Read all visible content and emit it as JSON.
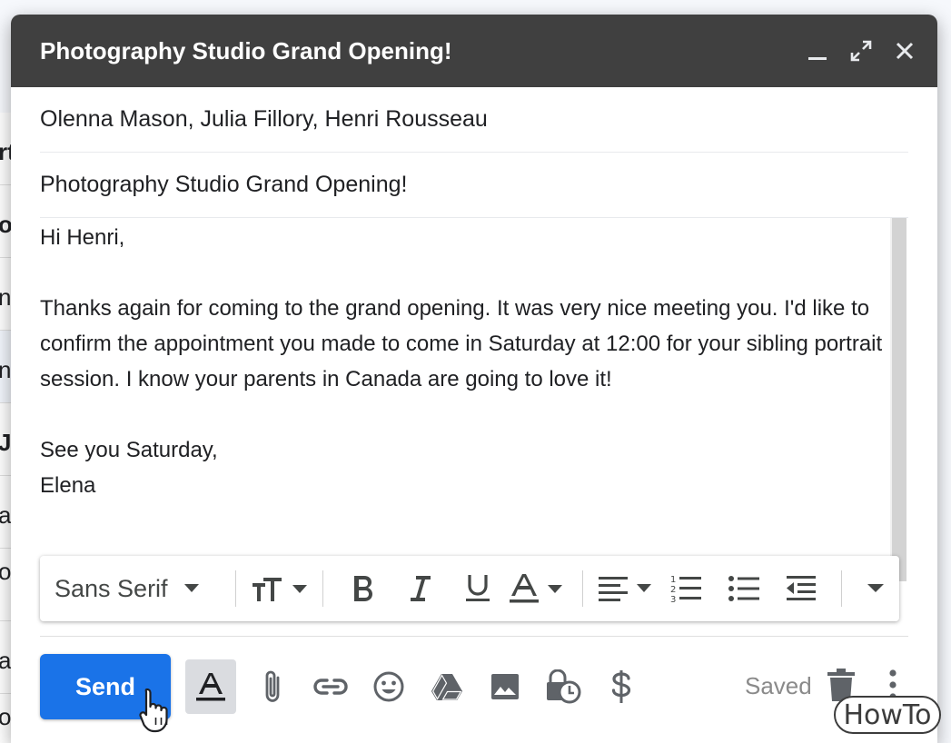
{
  "compose": {
    "title": "Photography Studio Grand Opening!",
    "recipients": "Olenna Mason, Julia Fillory, Henri Rousseau",
    "subject": "Photography Studio Grand Opening!",
    "body": {
      "greeting": "Hi Henri,",
      "paragraph": "Thanks again for coming to the grand opening. It was very nice meeting you. I'd like to confirm the appointment you made to come in Saturday at 12:00 for your sibling portrait session. I know your parents in Canada are going to love it!",
      "closing": "See you Saturday,",
      "signature": "Elena"
    }
  },
  "format_toolbar": {
    "font": "Sans Serif",
    "icons": [
      "font-size-icon",
      "bold-icon",
      "italic-icon",
      "underline-icon",
      "text-color-icon",
      "align-icon",
      "numbered-list-icon",
      "bulleted-list-icon",
      "indent-less-icon",
      "more-formatting-icon"
    ]
  },
  "actions": {
    "send_label": "Send",
    "saved_label": "Saved",
    "icons": [
      "formatting-options-icon",
      "attach-icon",
      "link-icon",
      "emoji-icon",
      "drive-icon",
      "photo-icon",
      "confidential-icon",
      "money-icon",
      "trash-icon",
      "more-icon"
    ]
  },
  "background": {
    "fragments": [
      "rt",
      "o",
      "n",
      "n",
      "J",
      "a",
      "o",
      "a",
      "o"
    ]
  },
  "watermark": "HowTo",
  "colors": {
    "titlebar": "#404040",
    "send_button": "#1a73e8",
    "saved_text": "#8a8a8a"
  }
}
